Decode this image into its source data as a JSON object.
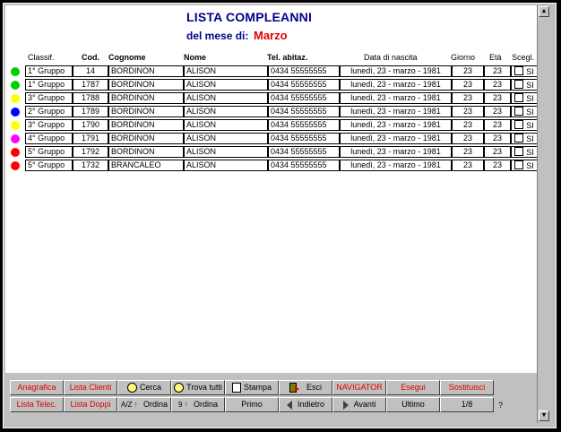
{
  "window": {
    "background": "#c0c0c0"
  },
  "header": {
    "title": "LISTA COMPLEANNI",
    "subtitle": "del mese di:",
    "month": "Marzo"
  },
  "table": {
    "columns": [
      "Classif.",
      "Cod.",
      "Cognome",
      "Nome",
      "Tel. abitaz.",
      "Data di nascita",
      "Giorno",
      "Età",
      "Scegl."
    ],
    "rows": [
      {
        "color": "#00d000",
        "classif": "1° Gruppo",
        "cod": "14",
        "cognome": "BORDINON",
        "nome": "ALISON",
        "tel": "0434 55555555",
        "data": "lunedì, 23 - marzo - 1981",
        "giorno": "23",
        "eta": "23",
        "scegl": "SI"
      },
      {
        "color": "#00d000",
        "classif": "1° Gruppo",
        "cod": "1787",
        "cognome": "BORDINON",
        "nome": "ALISON",
        "tel": "0434 55555555",
        "data": "lunedì, 23 - marzo - 1981",
        "giorno": "23",
        "eta": "23",
        "scegl": "SI"
      },
      {
        "color": "#ffff00",
        "classif": "3° Gruppo",
        "cod": "1788",
        "cognome": "BORDINON",
        "nome": "ALISON",
        "tel": "0434 55555555",
        "data": "lunedì, 23 - marzo - 1981",
        "giorno": "23",
        "eta": "23",
        "scegl": "SI"
      },
      {
        "color": "#0000ff",
        "classif": "2° Gruppo",
        "cod": "1789",
        "cognome": "BORDINON",
        "nome": "ALISON",
        "tel": "0434 55555555",
        "data": "lunedì, 23 - marzo - 1981",
        "giorno": "23",
        "eta": "23",
        "scegl": "SI"
      },
      {
        "color": "#ffff00",
        "classif": "3° Gruppo",
        "cod": "1790",
        "cognome": "BORDINON",
        "nome": "ALISON",
        "tel": "0434 55555555",
        "data": "lunedì, 23 - marzo - 1981",
        "giorno": "23",
        "eta": "23",
        "scegl": "SI"
      },
      {
        "color": "#ff00ff",
        "classif": "4° Gruppo",
        "cod": "1791",
        "cognome": "BORDINON",
        "nome": "ALISON",
        "tel": "0434 55555555",
        "data": "lunedì, 23 - marzo - 1981",
        "giorno": "23",
        "eta": "23",
        "scegl": "SI"
      },
      {
        "color": "#ff0000",
        "classif": "5° Gruppo",
        "cod": "1792",
        "cognome": "BORDINON",
        "nome": "ALISON",
        "tel": "0434 55555555",
        "data": "lunedì, 23 - marzo - 1981",
        "giorno": "23",
        "eta": "23",
        "scegl": "SI"
      },
      {
        "color": "#ff0000",
        "classif": "5° Gruppo",
        "cod": "1732",
        "cognome": "BRANCALEO",
        "nome": "ALISON",
        "tel": "0434 55555555",
        "data": "lunedì, 23 - marzo - 1981",
        "giorno": "23",
        "eta": "23",
        "scegl": "SI"
      }
    ]
  },
  "toolbar": {
    "anagrafica": "Anagrafica",
    "lista_clienti": "Lista Clienti",
    "cerca": "Cerca",
    "trova_tutti": "Trova tutti",
    "stampa": "Stampa",
    "esci": "Esci",
    "navigator": "NAVIGATOR",
    "esegui": "Esegui",
    "sostituisci": "Sostituisci",
    "lista_telec": "Lista Telec.",
    "lista_doppi": "Lista Doppi",
    "ordina_az": "Ordina",
    "ordina_az_glyph": "A/Z",
    "ordina_09": "Ordina",
    "ordina_09_glyph": "9",
    "primo": "Primo",
    "indietro": "Indietro",
    "avanti": "Avanti",
    "ultimo": "Ultimo",
    "record_counter": "1/8",
    "help": "?"
  },
  "icons": {
    "scroll_up": "scroll-up-arrow-icon",
    "scroll_down": "scroll-down-arrow-icon",
    "search": "clock-search-icon",
    "find_all": "clock-find-all-icon",
    "print": "print-icon",
    "exit": "exit-door-icon",
    "back": "triangle-left-icon",
    "forward": "triangle-right-icon"
  }
}
